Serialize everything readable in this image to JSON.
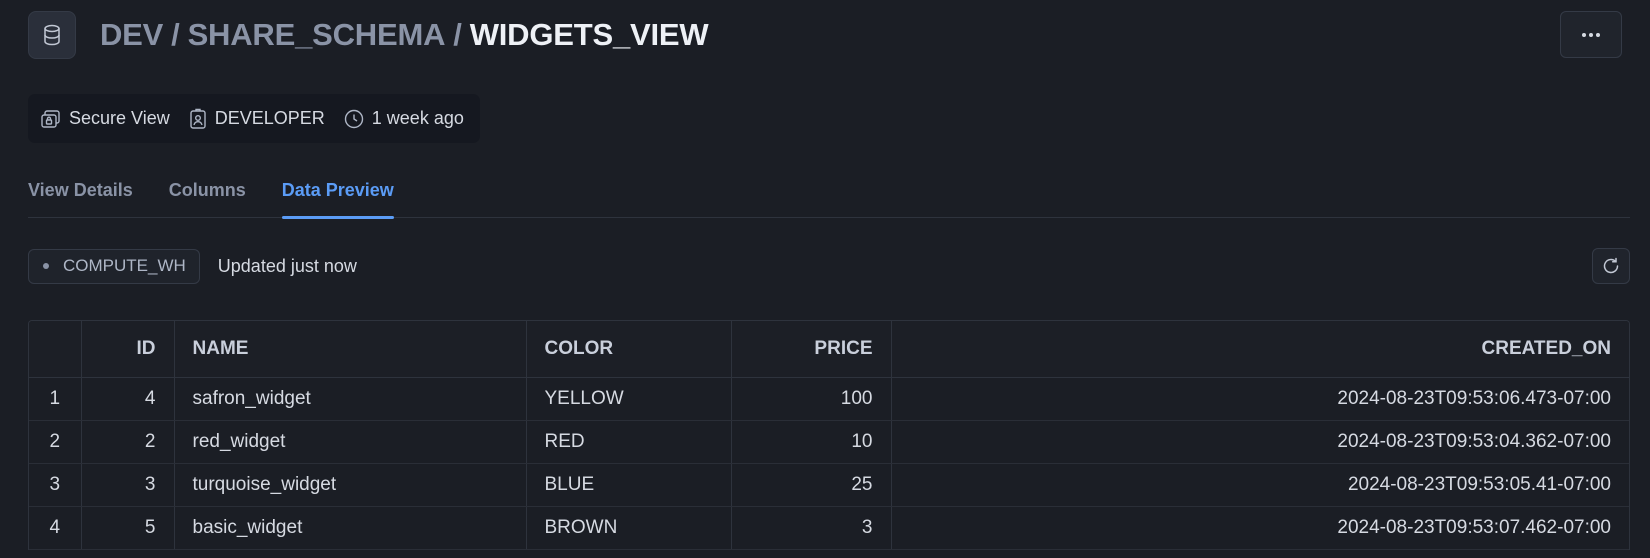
{
  "header": {
    "object_icon": "database-icon",
    "breadcrumb": [
      "DEV",
      "SHARE_SCHEMA"
    ],
    "separator": "/",
    "title": "WIDGETS_VIEW",
    "more_label": "···"
  },
  "meta": {
    "view_type": "Secure View",
    "view_type_icon": "secure-view-icon",
    "owner": "DEVELOPER",
    "owner_icon": "role-badge-icon",
    "last_altered": "1 week ago",
    "last_altered_icon": "clock-icon"
  },
  "tabs": [
    {
      "label": "View Details",
      "active": false
    },
    {
      "label": "Columns",
      "active": false
    },
    {
      "label": "Data Preview",
      "active": true
    }
  ],
  "toolbar": {
    "warehouse": "COMPUTE_WH",
    "updated": "Updated just now",
    "refresh_icon": "refresh-icon"
  },
  "table": {
    "columns": [
      "",
      "ID",
      "NAME",
      "COLOR",
      "PRICE",
      "CREATED_ON"
    ],
    "rows": [
      [
        "1",
        "4",
        "safron_widget",
        "YELLOW",
        "100",
        "2024-08-23T09:53:06.473-07:00"
      ],
      [
        "2",
        "2",
        "red_widget",
        "RED",
        "10",
        "2024-08-23T09:53:04.362-07:00"
      ],
      [
        "3",
        "3",
        "turquoise_widget",
        "BLUE",
        "25",
        "2024-08-23T09:53:05.41-07:00"
      ],
      [
        "4",
        "5",
        "basic_widget",
        "BROWN",
        "3",
        "2024-08-23T09:53:07.462-07:00"
      ]
    ]
  },
  "colors": {
    "background": "#1b1e25",
    "accent": "#5b9cf6",
    "muted_text": "#8a93a6"
  }
}
